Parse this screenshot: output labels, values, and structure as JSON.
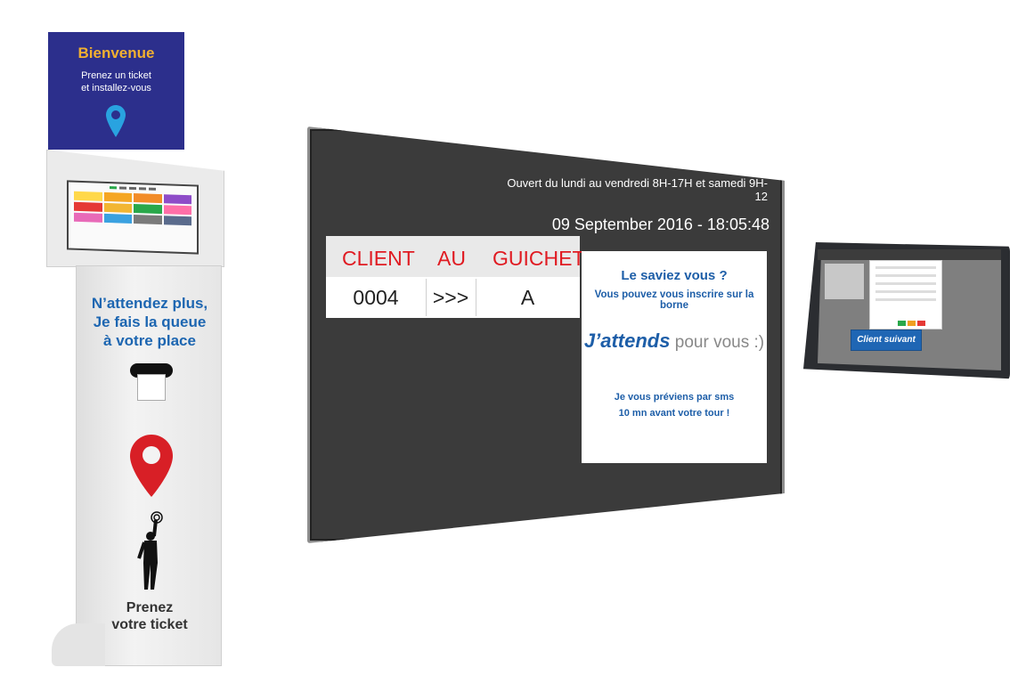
{
  "kiosk": {
    "header_title": "Bienvenue",
    "header_line1": "Prenez un ticket",
    "header_line2": "et installez-vous",
    "tagline_line1": "N’attendez plus,",
    "tagline_line2": "Je fais la queue",
    "tagline_line3": "à votre place",
    "cta_line1": "Prenez",
    "cta_line2": "votre ticket",
    "tile_colors": [
      "#ffd84a",
      "#f5a623",
      "#f28c28",
      "#8e4cc8",
      "#e53935",
      "#f2b632",
      "#29a84a",
      "#ff6fa8",
      "#e86ab8",
      "#3aa1e0",
      "#7a7a7a",
      "#5a6b8c"
    ]
  },
  "tv": {
    "hours": "Ouvert du lundi au vendredi 8H-17H et samedi 9H-12",
    "datetime": "09 September 2016 - 18:05:48",
    "table": {
      "headers": [
        "CLIENT",
        "AU",
        "GUICHET"
      ],
      "row": [
        "0004",
        ">>>",
        "A"
      ]
    },
    "info": {
      "question": "Le saviez vous ?",
      "subtitle": "Vous pouvez vous inscrire sur la borne",
      "wait_strong": "J’attends",
      "wait_light": " pour vous :)",
      "sms_line1": "Je vous préviens par sms",
      "sms_line2": "10 mn avant votre tour !"
    }
  },
  "tablet": {
    "next_button": "Client suivant"
  },
  "colors": {
    "kiosk_blue": "#2c2f8c",
    "accent_orange": "#f2b030",
    "text_blue": "#1d5ea8",
    "red": "#e01b22"
  }
}
